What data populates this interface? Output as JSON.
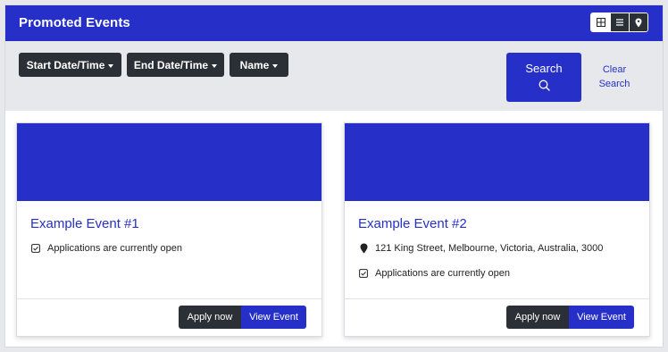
{
  "header": {
    "title": "Promoted Events",
    "view_modes": [
      {
        "name": "grid-icon"
      },
      {
        "name": "list-icon"
      },
      {
        "name": "map-pin-icon"
      }
    ]
  },
  "filters": {
    "start_label": "Start Date/Time",
    "end_label": "End Date/Time",
    "name_label": "Name",
    "search_label": "Search",
    "clear_label": "Clear Search"
  },
  "events": [
    {
      "title": "Example Event #1",
      "status": "Applications are currently open",
      "apply_label": "Apply now",
      "view_label": "View Event"
    },
    {
      "title": "Example Event #2",
      "address": "121 King Street, Melbourne, Victoria, Australia, 3000",
      "status": "Applications are currently open",
      "apply_label": "Apply now",
      "view_label": "View Event"
    }
  ],
  "colors": {
    "primary": "#2630c8",
    "dark": "#2b2f36",
    "filter_bg": "#e6e8ec"
  }
}
